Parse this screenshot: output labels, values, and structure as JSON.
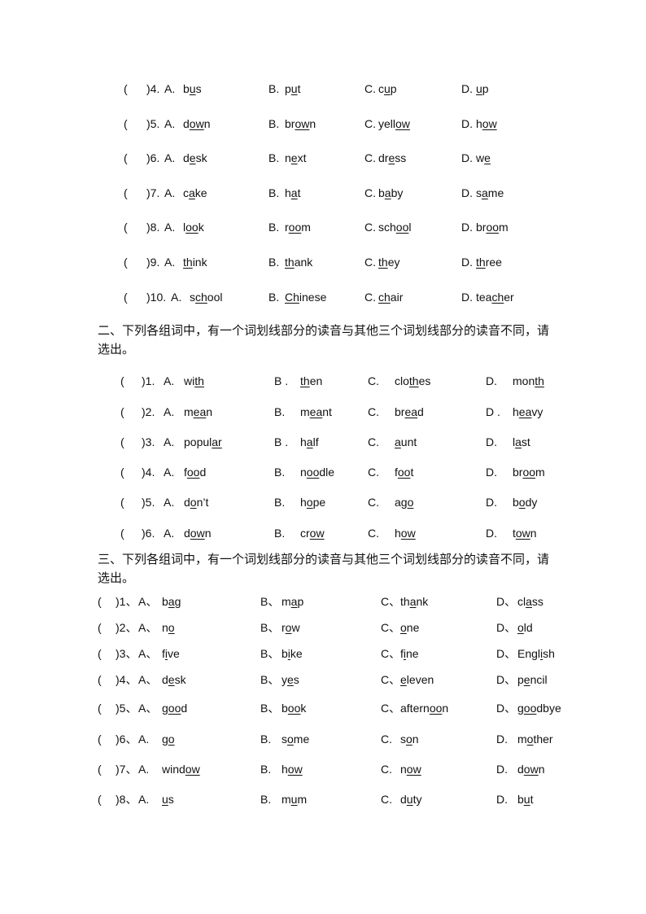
{
  "sections": [
    {
      "heading": "",
      "rows": [
        {
          "paren": "(",
          "num": ")4.",
          "options": [
            {
              "label": "A.",
              "word": [
                "b",
                "u",
                "s"
              ]
            },
            {
              "label": "B.",
              "word": [
                "p",
                "u",
                "t"
              ]
            },
            {
              "label": "C.",
              "word": [
                "c",
                "u",
                "p"
              ]
            },
            {
              "label": "D.",
              "word": [
                "",
                "u",
                "p"
              ]
            }
          ]
        },
        {
          "paren": "(",
          "num": ")5.",
          "options": [
            {
              "label": "A.",
              "word": [
                "d",
                "ow",
                "n"
              ]
            },
            {
              "label": "B.",
              "word": [
                "br",
                "ow",
                "n"
              ]
            },
            {
              "label": "C.",
              "word": [
                "yell",
                "ow",
                ""
              ]
            },
            {
              "label": "D.",
              "word": [
                "h",
                "ow",
                ""
              ]
            }
          ]
        },
        {
          "paren": "(",
          "num": ")6.",
          "options": [
            {
              "label": "A.",
              "word": [
                "d",
                "e",
                "sk"
              ]
            },
            {
              "label": "B.",
              "word": [
                "n",
                "e",
                "xt"
              ]
            },
            {
              "label": "C.",
              "word": [
                "dr",
                "e",
                "ss"
              ]
            },
            {
              "label": "D.",
              "word": [
                "w",
                "e",
                ""
              ]
            }
          ]
        },
        {
          "paren": "(",
          "num": ")7.",
          "options": [
            {
              "label": "A.",
              "word": [
                "c",
                "a",
                "ke"
              ]
            },
            {
              "label": "B.",
              "word": [
                "h",
                "a",
                "t"
              ]
            },
            {
              "label": "C.",
              "word": [
                "b",
                "a",
                "by"
              ]
            },
            {
              "label": "D.",
              "word": [
                "s",
                "a",
                "me"
              ]
            }
          ]
        },
        {
          "paren": "(",
          "num": ")8.",
          "options": [
            {
              "label": "A.",
              "word": [
                "l",
                "oo",
                "k"
              ]
            },
            {
              "label": "B.",
              "word": [
                "r",
                "oo",
                "m"
              ]
            },
            {
              "label": "C.",
              "word": [
                "sch",
                "oo",
                "l"
              ]
            },
            {
              "label": "D.",
              "word": [
                "br",
                "oo",
                "m"
              ]
            }
          ]
        },
        {
          "paren": "(",
          "num": ")9.",
          "options": [
            {
              "label": "A.",
              "word": [
                "",
                "th",
                "ink"
              ]
            },
            {
              "label": "B.",
              "word": [
                "",
                "th",
                "ank"
              ]
            },
            {
              "label": "C.",
              "word": [
                "",
                "th",
                "ey"
              ]
            },
            {
              "label": "D.",
              "word": [
                "",
                "th",
                "ree"
              ]
            }
          ]
        },
        {
          "paren": "(",
          "num": ")10.",
          "options": [
            {
              "label": "A.",
              "word": [
                "s",
                "ch",
                "ool"
              ]
            },
            {
              "label": "B.",
              "word": [
                "",
                "Ch",
                "inese"
              ]
            },
            {
              "label": "C.",
              "word": [
                "",
                "ch",
                "air"
              ]
            },
            {
              "label": "D.",
              "word": [
                "tea",
                "ch",
                "er"
              ]
            }
          ]
        }
      ]
    },
    {
      "heading": "二、下列各组词中，有一个词划线部分的读音与其他三个词划线部分的读音不同，请选出。",
      "rows": [
        {
          "paren": "(",
          "num": ")1.",
          "options": [
            {
              "label": "A.",
              "word": [
                "wi",
                "th",
                ""
              ]
            },
            {
              "label": "B .",
              "word": [
                "",
                "th",
                "en"
              ]
            },
            {
              "label": "C.",
              "word": [
                "clo",
                "th",
                "es"
              ]
            },
            {
              "label": "D.",
              "word": [
                "mon",
                "th",
                ""
              ]
            }
          ]
        },
        {
          "paren": "(",
          "num": ")2.",
          "options": [
            {
              "label": "A.",
              "word": [
                "m",
                "ea",
                "n"
              ]
            },
            {
              "label": "B.",
              "word": [
                "m",
                "ea",
                "nt"
              ]
            },
            {
              "label": "C.",
              "word": [
                "br",
                "ea",
                "d"
              ]
            },
            {
              "label": "D .",
              "word": [
                "h",
                "ea",
                "vy"
              ]
            }
          ]
        },
        {
          "paren": "(",
          "num": ")3.",
          "options": [
            {
              "label": "A.",
              "word": [
                "popul",
                "ar",
                ""
              ]
            },
            {
              "label": "B .",
              "word": [
                "h",
                "a",
                "lf"
              ]
            },
            {
              "label": "C.",
              "word": [
                "",
                "a",
                "unt"
              ]
            },
            {
              "label": "D.",
              "word": [
                "l",
                "a",
                "st"
              ]
            }
          ]
        },
        {
          "paren": "(",
          "num": ")4.",
          "options": [
            {
              "label": "A.",
              "word": [
                "f",
                "oo",
                "d"
              ]
            },
            {
              "label": "B.",
              "word": [
                "n",
                "oo",
                "dle"
              ]
            },
            {
              "label": "C.",
              "word": [
                "f",
                "oo",
                "t"
              ]
            },
            {
              "label": "D.",
              "word": [
                "br",
                "oo",
                "m"
              ]
            }
          ]
        },
        {
          "paren": "(",
          "num": ")5.",
          "options": [
            {
              "label": "A.",
              "word": [
                "d",
                "o",
                "n’t"
              ]
            },
            {
              "label": "B.",
              "word": [
                "h",
                "o",
                "pe"
              ]
            },
            {
              "label": "C.",
              "word": [
                "ag",
                "o",
                ""
              ]
            },
            {
              "label": "D.",
              "word": [
                "b",
                "o",
                "dy"
              ]
            }
          ]
        },
        {
          "paren": "(",
          "num": ")6.",
          "options": [
            {
              "label": "A.",
              "word": [
                "d",
                "ow",
                "n"
              ]
            },
            {
              "label": "B.",
              "word": [
                "cr",
                "ow",
                ""
              ]
            },
            {
              "label": "C.",
              "word": [
                "h",
                "ow",
                ""
              ]
            },
            {
              "label": "D.",
              "word": [
                "t",
                "ow",
                "n"
              ]
            }
          ]
        }
      ]
    },
    {
      "heading": "三、下列各组词中，有一个词划线部分的读音与其他三个词划线部分的读音不同，请选出。",
      "rows": [
        {
          "paren": "(",
          "num": ")1、",
          "options": [
            {
              "label": "A、",
              "word": [
                "b",
                "a",
                "g"
              ]
            },
            {
              "label": "B、",
              "word": [
                "m",
                "a",
                "p"
              ]
            },
            {
              "label": "C、",
              "word": [
                "th",
                "a",
                "nk"
              ]
            },
            {
              "label": "D、",
              "word": [
                "cl",
                "a",
                "ss"
              ]
            }
          ]
        },
        {
          "paren": "(",
          "num": ")2、",
          "options": [
            {
              "label": "A、",
              "word": [
                "n",
                "o",
                ""
              ]
            },
            {
              "label": "B、",
              "word": [
                "r",
                "o",
                "w"
              ]
            },
            {
              "label": "C、",
              "word": [
                "",
                "o",
                "ne"
              ]
            },
            {
              "label": "D、",
              "word": [
                "",
                "o",
                "ld"
              ]
            }
          ]
        },
        {
          "paren": "(",
          "num": ")3、",
          "options": [
            {
              "label": "A、",
              "word": [
                "f",
                "i",
                "ve"
              ]
            },
            {
              "label": "B、",
              "word": [
                "b",
                "i",
                "ke"
              ]
            },
            {
              "label": "C、",
              "word": [
                "f",
                "i",
                "ne"
              ]
            },
            {
              "label": "D、",
              "word": [
                "Engl",
                "i",
                "sh"
              ]
            }
          ]
        },
        {
          "paren": "(",
          "num": ")4、",
          "options": [
            {
              "label": "A、",
              "word": [
                "d",
                "e",
                "sk"
              ]
            },
            {
              "label": "B、",
              "word": [
                "y",
                "e",
                "s"
              ]
            },
            {
              "label": "C、",
              "word": [
                "",
                "e",
                "leven"
              ]
            },
            {
              "label": "D、",
              "word": [
                "p",
                "e",
                "ncil"
              ]
            }
          ]
        },
        {
          "paren": "(",
          "num": ")5、",
          "options": [
            {
              "label": "A、",
              "word": [
                "g",
                "oo",
                "d"
              ]
            },
            {
              "label": "B、",
              "word": [
                "b",
                "oo",
                "k"
              ]
            },
            {
              "label": "C、",
              "word": [
                "aftern",
                "oo",
                "n"
              ]
            },
            {
              "label": "D、",
              "word": [
                "g",
                "oo",
                "dbye"
              ]
            }
          ]
        },
        {
          "paren": "(",
          "num": ")6、",
          "options": [
            {
              "label": "A.",
              "word": [
                "g",
                "o",
                ""
              ]
            },
            {
              "label": "B.",
              "word": [
                "s",
                "o",
                "me"
              ]
            },
            {
              "label": "C.",
              "word": [
                "s",
                "o",
                "n"
              ]
            },
            {
              "label": "D.",
              "word": [
                "m",
                "o",
                "ther"
              ]
            }
          ]
        },
        {
          "paren": "(",
          "num": ")7、",
          "options": [
            {
              "label": "A.",
              "word": [
                "wind",
                "ow",
                ""
              ]
            },
            {
              "label": "B.",
              "word": [
                "h",
                "ow",
                ""
              ]
            },
            {
              "label": "C.",
              "word": [
                "n",
                "ow",
                ""
              ]
            },
            {
              "label": "D.",
              "word": [
                "d",
                "ow",
                "n"
              ]
            }
          ]
        },
        {
          "paren": "(",
          "num": ")8、",
          "options": [
            {
              "label": "A.",
              "word": [
                "",
                "u",
                "s"
              ]
            },
            {
              "label": "B.",
              "word": [
                "m",
                "u",
                "m"
              ]
            },
            {
              "label": "C.",
              "word": [
                "d",
                "u",
                "ty"
              ]
            },
            {
              "label": "D.",
              "word": [
                "b",
                "u",
                "t"
              ]
            }
          ]
        }
      ]
    }
  ]
}
